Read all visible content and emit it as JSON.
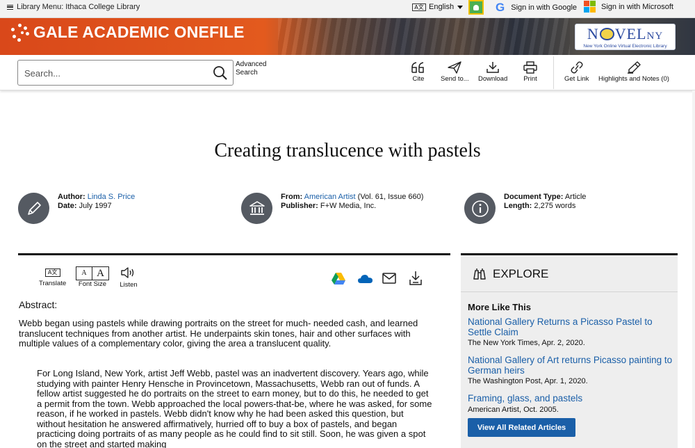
{
  "topbar": {
    "library_menu": "Library Menu: Ithaca College Library",
    "language": "English",
    "sign_google": "Sign in with Google",
    "sign_microsoft": "Sign in with Microsoft"
  },
  "banner": {
    "brand": "GALE ACADEMIC ONEFILE",
    "novel_logo": "NOVELny",
    "novel_sub": "New York Online Virtual Electronic Library"
  },
  "toolbar": {
    "search_placeholder": "Search...",
    "advanced_line1": "Advanced",
    "advanced_line2": "Search",
    "cite": "Cite",
    "send_to": "Send to...",
    "download": "Download",
    "print": "Print",
    "get_link": "Get Link",
    "highlights": "Highlights and Notes (0)"
  },
  "article": {
    "title": "Creating translucence with pastels",
    "author_label": "Author:",
    "author": "Linda S. Price",
    "date_label": "Date:",
    "date": "July 1997",
    "from_label": "From:",
    "from_source": "American Artist",
    "from_issue": "(Vol. 61, Issue 660)",
    "publisher_label": "Publisher:",
    "publisher": "F+W Media, Inc.",
    "doctype_label": "Document Type:",
    "doctype": "Article",
    "length_label": "Length:",
    "length": "2,275 words",
    "translate": "Translate",
    "font_size": "Font Size",
    "listen": "Listen",
    "abstract_heading": "Abstract:",
    "abstract": "Webb began using pastels while drawing portraits on the street for much- needed cash, and learned translucent techniques from another artist. He underpaints skin tones, hair and other surfaces with multiple values of a complementary color, giving the area a translucent quality.",
    "body": "For Long Island, New York, artist Jeff Webb, pastel was an inadvertent discovery. Years ago, while studying with painter Henry Hensche in Provincetown, Massachusetts, Webb ran out of funds. A fellow artist suggested he do portraits on the street to earn money, but to do this, he needed to get a permit from the town. Webb approached the local powers-that-be, where he was asked, for some reason, if he worked in pastels. Webb didn't know why he had been asked this question, but without hesitation he answered affirmatively, hurried off to buy a box of pastels, and began practicing doing portraits of as many people as he could find to sit still. Soon, he was given a spot on the street and started making"
  },
  "explore": {
    "heading": "EXPLORE",
    "more_like_this": "More Like This",
    "related": [
      {
        "title": "National Gallery Returns a Picasso Pastel to Settle Claim",
        "source": "The New York Times, Apr. 2, 2020."
      },
      {
        "title": "National Gallery of Art returns Picasso painting to German heirs",
        "source": "The Washington Post, Apr. 1, 2020."
      },
      {
        "title": "Framing, glass, and pastels",
        "source": "American Artist, Oct. 2005."
      }
    ],
    "view_all": "View All Related Articles"
  },
  "colors": {
    "banner_orange": "#d9481a",
    "link_blue": "#1a5fa8",
    "icon_gray": "#555a62",
    "panel_gray": "#eeeeee"
  }
}
